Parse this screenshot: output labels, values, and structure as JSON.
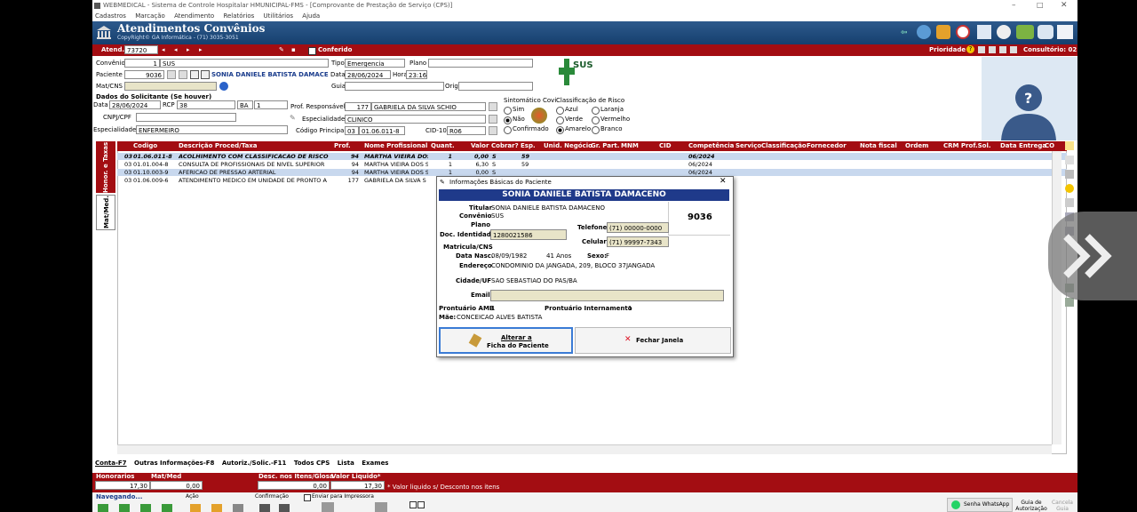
{
  "window": {
    "title": "WEBMEDICAL - Sistema de Controle Hospitalar HMUNICIPAL-FMS - [Comprovante de Prestação de Serviço (CPS)]",
    "controls": [
      "–",
      "□",
      "✕"
    ]
  },
  "menu": [
    "Cadastros",
    "Marcação",
    "Atendimento",
    "Relatórios",
    "Utilitários",
    "Ajuda"
  ],
  "header": {
    "title": "Atendimentos Convênios",
    "subtitle": "CopyRight© GA Informática - (71) 3035-3051"
  },
  "toolbar": {
    "atend_label": "Atend.",
    "atend_value": "73720",
    "conferido_label": "Conferido",
    "prioridade_label": "Prioridade",
    "consultorio_label": "Consultório: 02"
  },
  "form": {
    "convenio_label": "Convênio",
    "convenio_code": "1",
    "convenio_name": "SUS",
    "tipo_label": "Tipo",
    "tipo_value": "Emergencia",
    "plano_label": "Plano",
    "plano_value": "",
    "paciente_label": "Paciente",
    "paciente_code": "9036",
    "paciente_name": "SONIA DANIELE BATISTA DAMACENO",
    "data_label": "Data",
    "data_value": "28/06/2024",
    "hora_label": "Hora",
    "hora_value": "23:16",
    "matcns_label": "Mat/CNS",
    "matcns_value": "",
    "guia_label": "Guia",
    "guia_value": "",
    "orig_label": "Orig.",
    "orig_value": "",
    "solicitante_title": "Dados do Solicitante (Se houver)",
    "sol_data_label": "Data",
    "sol_data_value": "28/06/2024",
    "rcp_label": "RCP",
    "rcp_value": "38",
    "uf_value": "BA",
    "num_value": "1",
    "cnpj_label": "CNPJ/CPF",
    "cnpj_value": "",
    "especialidade_label": "Especialidade",
    "especialidade_value": "ENFERMEIRO",
    "prof_resp_label": "Prof. Responsável",
    "prof_resp_code": "177",
    "prof_resp_name": "GABRIELA DA SILVA SCHIO",
    "esp2_label": "Especialidade",
    "esp2_value": "CLINICO",
    "cod_principal_label": "Código Principal",
    "cod_principal_a": "03",
    "cod_principal_b": "01.06.011-8",
    "cid_label": "CID-10",
    "cid_value": "R06",
    "sintomatico_label": "Sintomático Covi",
    "sintomatico_options": [
      "Sim",
      "Não",
      "Confirmado"
    ],
    "classif_label": "Classificação de Risco",
    "classif_options": [
      "Azul",
      "Laranja",
      "Verde",
      "Vermelho",
      "Amarelo",
      "Branco"
    ]
  },
  "sus_logo": "SUS",
  "vtabs": [
    "Honor. e Taxas",
    "Mat/Med."
  ],
  "grid": {
    "columns": [
      "Codigo",
      "Descrição Proced/Taxa",
      "Prof.",
      "Nome Profissional",
      "Quant.",
      "Valor",
      "Cobrar?",
      "Esp.",
      "Unid. Negócio",
      "Gr. Part.",
      "MNM",
      "CID",
      "Competência",
      "Serviço",
      "Classificação",
      "Fornecedor",
      "Nota fiscal",
      "Ordem",
      "CRM Prof.Sol.",
      "Data Entrega",
      "CO"
    ],
    "rows": [
      {
        "grp": "03",
        "code": "01.06.011-8",
        "desc": "ACOLHIMENTO COM CLASSIFICACAO DE RISCO",
        "prof": "94",
        "nome": "MARTHA VIEIRA DOS",
        "quant": "1",
        "valor": "0,00",
        "cobrar": "S",
        "esp": "59",
        "comp": "06/2024"
      },
      {
        "grp": "03",
        "code": "01.01.004-8",
        "desc": "CONSULTA DE PROFISSIONAIS DE NIVEL SUPERIOR",
        "prof": "94",
        "nome": "MARTHA VIEIRA DOS S",
        "quant": "1",
        "valor": "6,30",
        "cobrar": "S",
        "esp": "59",
        "comp": "06/2024"
      },
      {
        "grp": "03",
        "code": "01.10.003-9",
        "desc": "AFERICAO DE PRESSAO ARTERIAL",
        "prof": "94",
        "nome": "MARTHA VIEIRA DOS S",
        "quant": "1",
        "valor": "0,00",
        "cobrar": "S",
        "esp": "",
        "comp": "06/2024"
      },
      {
        "grp": "03",
        "code": "01.06.009-6",
        "desc": "ATENDIMENTO MEDICO EM UNIDADE DE PRONTO A",
        "prof": "177",
        "nome": "GABRIELA DA SILVA S",
        "quant": "",
        "valor": "",
        "cobrar": "",
        "esp": "",
        "comp": ""
      }
    ]
  },
  "dialog": {
    "title": "Informações Básicas do Paciente",
    "name": "SONIA DANIELE BATISTA DAMACENO",
    "titular_label": "Titular",
    "titular_value": "SONIA DANIELE BATISTA DAMACENO",
    "convenio_label": "Convênio",
    "convenio_value": "SUS",
    "plano_label": "Plano",
    "plano_value": "",
    "code": "9036",
    "doc_label": "Doc. Identidade",
    "doc_value": "1280021586",
    "telefone_label": "Telefone",
    "telefone_value": "(71) 00000-0000",
    "celular_label": "Celular",
    "celular_value": "(71) 99997-7343",
    "matricula_label": "Matricula/CNS",
    "nasc_label": "Data Nasc.",
    "nasc_value": "08/09/1982",
    "idade_value": "41 Anos",
    "sexo_label": "Sexo:",
    "sexo_value": "F",
    "endereco_label": "Endereço",
    "endereco_value": "CONDOMINIO DA JANGADA, 209, BLOCO 37JANGADA",
    "cidade_label": "Cidade/UF",
    "cidade_value": "SAO SEBASTIAO DO PAS/BA",
    "email_label": "Email",
    "email_value": "",
    "pront_amb_label": "Prontuário AMB",
    "pront_amb_value": "1",
    "pront_int_label": "Prontuário Internamento",
    "pront_int_value": "1",
    "mae_label": "Mãe:",
    "mae_value": "CONCEICAO ALVES BATISTA",
    "alterar_label_1": "Alterar a",
    "alterar_label_2": "Ficha do Paciente",
    "fechar_label": "Fechar Janela"
  },
  "bottom_tabs": [
    "Conta-F7",
    "Outras Informações-F8",
    "Autoriz./Solic.-F11",
    "Todos CPS",
    "Lista",
    "Exames"
  ],
  "totals": {
    "honorarios_label": "Honorarios",
    "honorarios_value": "17,30",
    "matmed_label": "Mat/Med",
    "matmed_value": "0,00",
    "desc_label": "Desc. nos Itens/Glosa",
    "desc_value": "0,00",
    "liquido_label": "Valor Liquido*",
    "liquido_value": "17,30",
    "note": "* Valor liquido s/ Desconto nos itens"
  },
  "footer": {
    "navegando": "Navegando...",
    "acao": "Ação",
    "confirmacao": "Confirmação",
    "enviar_label": "Enviar para Impressora",
    "senha_label": "Senha WhatsApp",
    "guia_label": "Guia de Autorização",
    "cancela_label": "Cancela Guia"
  },
  "colors": {
    "brand_red": "#a30d12",
    "header_blue": "#1f4a7c",
    "selected_row": "#c8d8ee"
  }
}
